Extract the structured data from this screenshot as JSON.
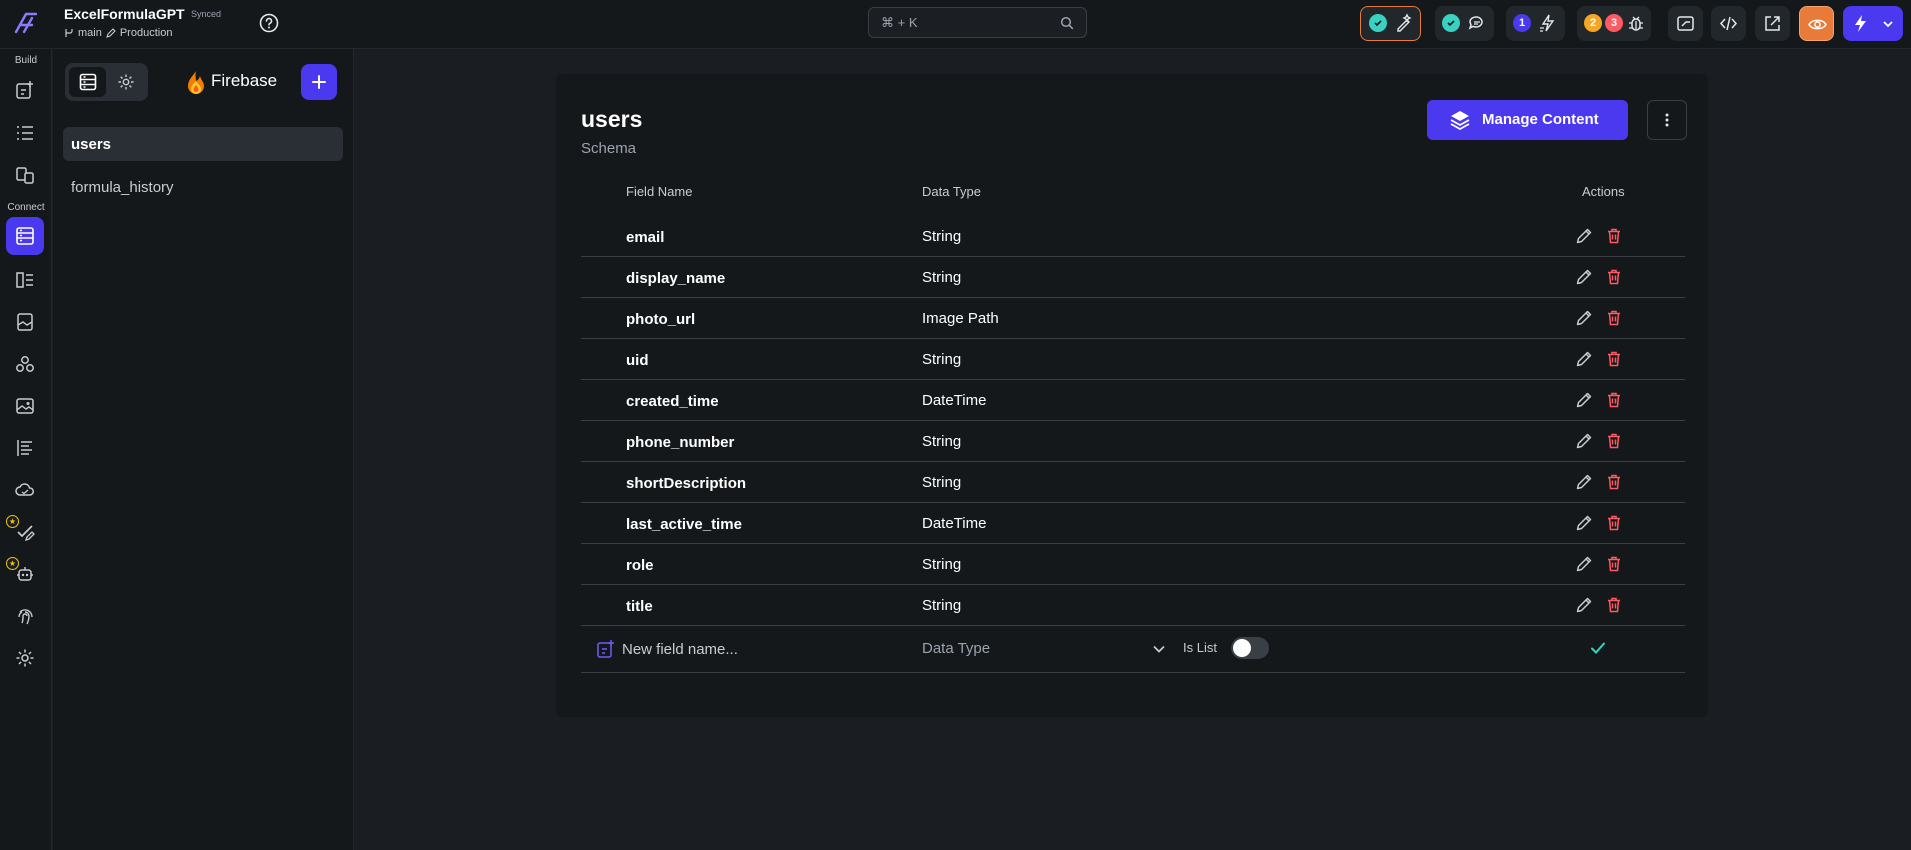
{
  "project": {
    "name": "ExcelFormulaGPT",
    "sync_status": "Synced",
    "branch": "main",
    "environment": "Production"
  },
  "search": {
    "placeholder": "⌘ + K"
  },
  "toolbar": {
    "badges": [
      "1",
      "2",
      "3"
    ]
  },
  "rail": {
    "build_label": "Build",
    "connect_label": "Connect"
  },
  "panel": {
    "provider": "Firebase",
    "collections": [
      "users",
      "formula_history"
    ],
    "selected_collection": "users"
  },
  "collection": {
    "name": "users",
    "subtitle": "Schema",
    "manage_label": "Manage Content",
    "columns": {
      "field_name": "Field Name",
      "data_type": "Data Type",
      "actions": "Actions"
    },
    "fields": [
      {
        "name": "email",
        "type": "String"
      },
      {
        "name": "display_name",
        "type": "String"
      },
      {
        "name": "photo_url",
        "type": "Image Path"
      },
      {
        "name": "uid",
        "type": "String"
      },
      {
        "name": "created_time",
        "type": "DateTime"
      },
      {
        "name": "phone_number",
        "type": "String"
      },
      {
        "name": "shortDescription",
        "type": "String"
      },
      {
        "name": "last_active_time",
        "type": "DateTime"
      },
      {
        "name": "role",
        "type": "String"
      },
      {
        "name": "title",
        "type": "String"
      }
    ],
    "new_field": {
      "name_placeholder": "New field name...",
      "type_placeholder": "Data Type",
      "is_list_label": "Is List",
      "is_list": false
    }
  },
  "colors": {
    "accent": "#4b39ef",
    "success": "#39d2c0",
    "danger": "#ff5963",
    "warning": "#f5a623"
  }
}
